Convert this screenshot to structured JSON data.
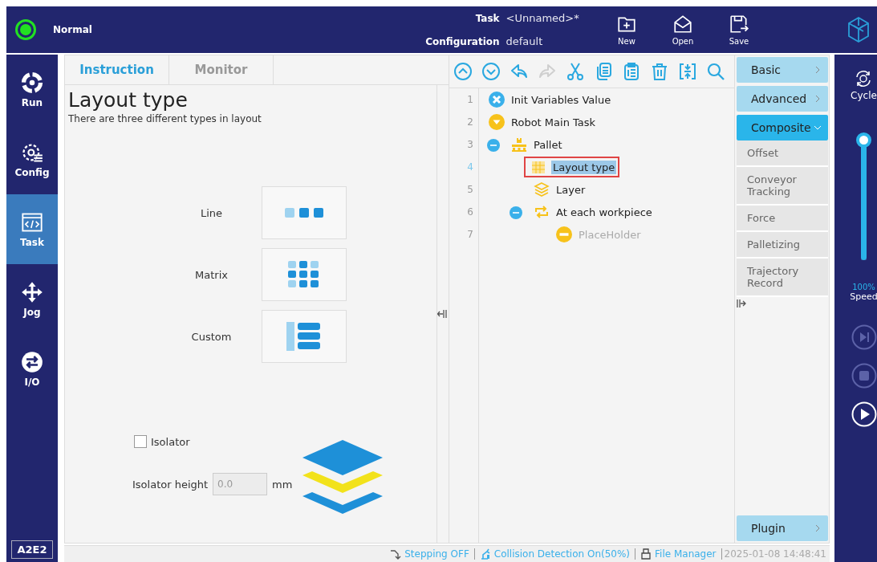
{
  "header": {
    "status": "Normal",
    "task_label": "Task",
    "task_value": "<Unnamed>*",
    "config_label": "Configuration",
    "config_value": "default",
    "buttons": [
      {
        "kind": "new",
        "label": "New"
      },
      {
        "kind": "open",
        "label": "Open"
      },
      {
        "kind": "save",
        "label": "Save"
      }
    ]
  },
  "nav": {
    "items": [
      {
        "kind": "run",
        "label": "Run",
        "selected": false
      },
      {
        "kind": "config",
        "label": "Config",
        "selected": false
      },
      {
        "kind": "task",
        "label": "Task",
        "selected": true
      },
      {
        "kind": "jog",
        "label": "Jog",
        "selected": false
      },
      {
        "kind": "io",
        "label": "I/O",
        "selected": false
      }
    ],
    "badge": "A2E2"
  },
  "instruction": {
    "tabs": [
      {
        "label": "Instruction",
        "selected": true
      },
      {
        "label": "Monitor",
        "selected": false
      }
    ],
    "title": "Layout type",
    "description": "There are three different types in layout",
    "layouts": [
      {
        "kind": "line",
        "label": "Line"
      },
      {
        "kind": "matrix",
        "label": "Matrix"
      },
      {
        "kind": "custom",
        "label": "Custom"
      }
    ],
    "isolator": {
      "label": "Isolator",
      "checked": false
    },
    "isolator_height": {
      "label": "Isolator height",
      "value": "0.0",
      "unit": "mm",
      "disabled": true
    }
  },
  "program": {
    "tools": [
      {
        "kind": "up",
        "disabled": false
      },
      {
        "kind": "down",
        "disabled": false
      },
      {
        "kind": "undo",
        "disabled": false
      },
      {
        "kind": "redo",
        "disabled": true
      },
      {
        "kind": "cut",
        "disabled": false
      },
      {
        "kind": "copy",
        "disabled": false
      },
      {
        "kind": "paste",
        "disabled": false
      },
      {
        "kind": "delete",
        "disabled": false
      },
      {
        "kind": "compress",
        "disabled": false
      },
      {
        "kind": "search",
        "disabled": false
      }
    ],
    "tree": [
      {
        "number": "1",
        "label": "Init Variables Value",
        "kind": "variable",
        "selected": false,
        "disabled": false
      },
      {
        "number": "2",
        "label": "Robot Main Task",
        "kind": "task",
        "selected": false,
        "disabled": false,
        "children": [
          {
            "number": "3",
            "label": "Pallet",
            "kind": "pallet",
            "selected": false,
            "disabled": false,
            "expanded": true,
            "children": [
              {
                "number": "4",
                "label": "Layout type",
                "kind": "layout",
                "selected": true,
                "disabled": false
              },
              {
                "number": "5",
                "label": "Layer",
                "kind": "layer",
                "selected": false,
                "disabled": false
              },
              {
                "number": "6",
                "label": "At each workpiece",
                "kind": "loop",
                "selected": false,
                "disabled": false,
                "expanded": true,
                "children": [
                  {
                    "number": "7",
                    "label": "PlaceHolder",
                    "kind": "placeholder",
                    "selected": false,
                    "disabled": true
                  }
                ]
              }
            ]
          }
        ]
      }
    ]
  },
  "palette": {
    "categories": [
      {
        "label": "Basic",
        "expanded": false
      },
      {
        "label": "Advanced",
        "expanded": false
      },
      {
        "label": "Composite",
        "expanded": true,
        "items": [
          "Offset",
          "Conveyor Tracking",
          "Force",
          "Palletizing",
          "Trajectory Record"
        ]
      },
      {
        "label": "Plugin",
        "expanded": false
      }
    ]
  },
  "run_panel": {
    "mode": "Cycle",
    "speed": {
      "level": 1,
      "reading": "100%",
      "label": "Speed"
    },
    "controls": [
      {
        "kind": "step",
        "disabled": true
      },
      {
        "kind": "stop",
        "disabled": true
      },
      {
        "kind": "play",
        "disabled": false
      }
    ]
  },
  "status_bar": {
    "stepping": "Stepping OFF",
    "collision": "Collision Detection On(50%)",
    "file_manager": "File Manager",
    "time": "2025-01-08 14:48:41"
  }
}
